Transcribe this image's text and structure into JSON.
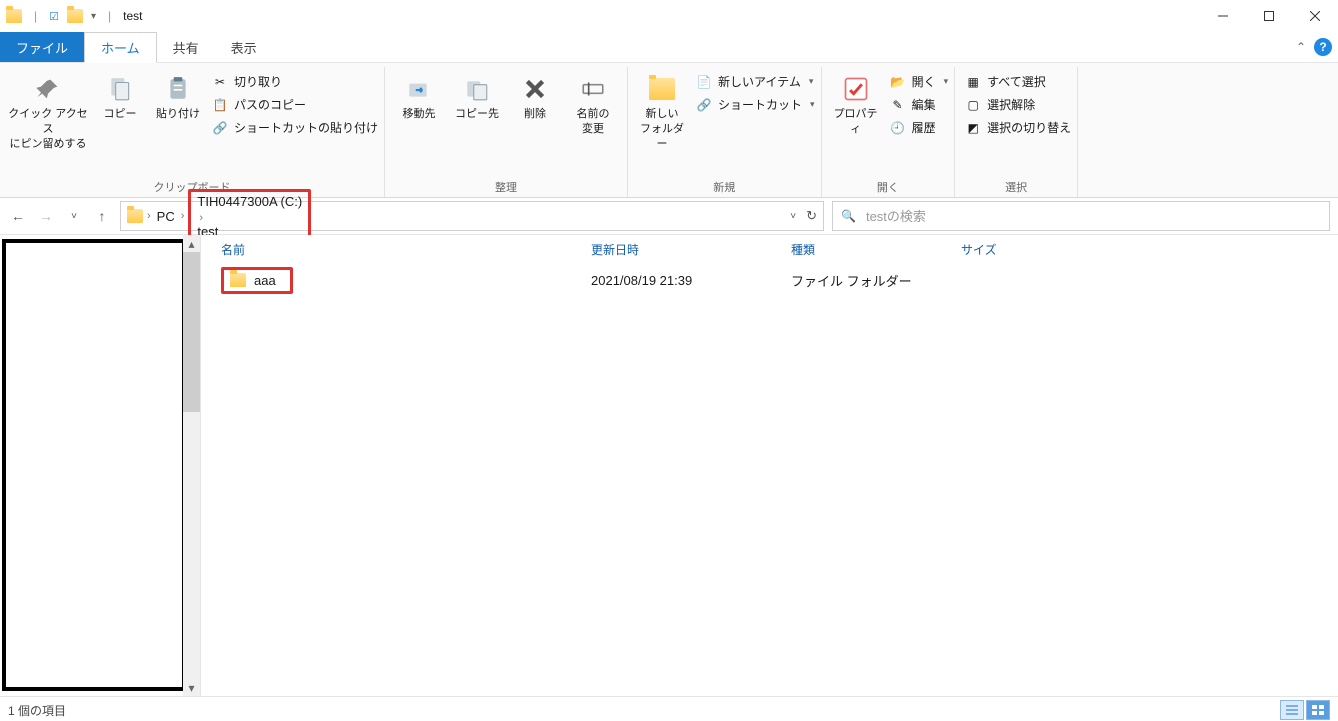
{
  "title": {
    "window_title": "test"
  },
  "tabs": {
    "file": "ファイル",
    "home": "ホーム",
    "share": "共有",
    "view": "表示"
  },
  "ribbon": {
    "clipboard": {
      "pin": "クイック アクセス\nにピン留めする",
      "copy": "コピー",
      "paste": "貼り付け",
      "cut": "切り取り",
      "copy_path": "パスのコピー",
      "paste_shortcut": "ショートカットの貼り付け",
      "group": "クリップボード"
    },
    "organize": {
      "move_to": "移動先",
      "copy_to": "コピー先",
      "delete": "削除",
      "rename": "名前の\n変更",
      "group": "整理"
    },
    "new": {
      "new_folder": "新しい\nフォルダー",
      "new_item": "新しいアイテム",
      "shortcut": "ショートカット",
      "group": "新規"
    },
    "open": {
      "properties": "プロパティ",
      "open": "開く",
      "edit": "編集",
      "history": "履歴",
      "group": "開く"
    },
    "select": {
      "select_all": "すべて選択",
      "select_none": "選択解除",
      "invert": "選択の切り替え",
      "group": "選択"
    }
  },
  "breadcrumb": {
    "pc": "PC",
    "drive": "TIH0447300A (C:)",
    "folder": "test"
  },
  "search": {
    "placeholder": "testの検索"
  },
  "columns": {
    "name": "名前",
    "date": "更新日時",
    "type": "種類",
    "size": "サイズ"
  },
  "items": [
    {
      "name": "aaa",
      "date": "2021/08/19 21:39",
      "type": "ファイル フォルダー",
      "size": ""
    }
  ],
  "status": {
    "count": "1 個の項目"
  }
}
